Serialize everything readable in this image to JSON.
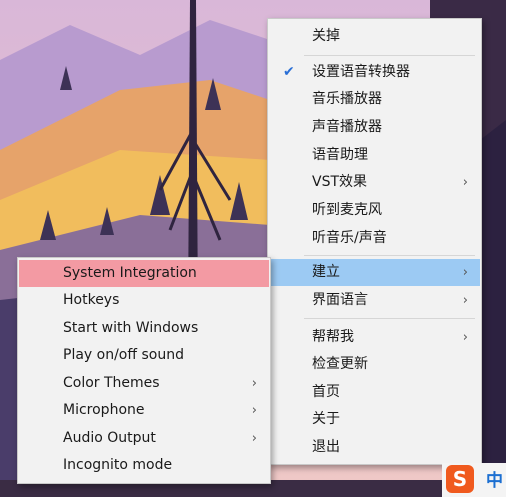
{
  "main_menu": {
    "items": [
      {
        "label": "关掉"
      },
      {
        "label": "设置语音转换器",
        "checked": true
      },
      {
        "label": "音乐播放器"
      },
      {
        "label": "声音播放器"
      },
      {
        "label": "语音助理"
      },
      {
        "label": "VST效果",
        "submenu": true
      },
      {
        "label": "听到麦克风"
      },
      {
        "label": "听音乐/声音"
      },
      {
        "label": "建立",
        "submenu": true,
        "highlighted": true
      },
      {
        "label": "界面语言",
        "submenu": true
      },
      {
        "label": "帮帮我",
        "submenu": true
      },
      {
        "label": "检查更新"
      },
      {
        "label": "首页"
      },
      {
        "label": "关于"
      },
      {
        "label": "退出"
      }
    ]
  },
  "sub_menu": {
    "items": [
      {
        "label": "System Integration",
        "highlighted": true
      },
      {
        "label": "Hotkeys"
      },
      {
        "label": "Start with Windows"
      },
      {
        "label": "Play on/off sound"
      },
      {
        "label": "Color Themes",
        "submenu": true
      },
      {
        "label": "Microphone",
        "submenu": true
      },
      {
        "label": "Audio Output",
        "submenu": true
      },
      {
        "label": "Incognito mode"
      }
    ]
  },
  "tray": {
    "ime_logo": "S",
    "ime_mode": "中"
  },
  "colors": {
    "main_highlight": "#9ccaf3",
    "sub_highlight": "#f39aa3",
    "menu_bg": "#f2f2f2"
  }
}
